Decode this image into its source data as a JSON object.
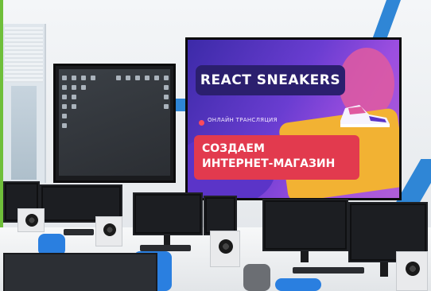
{
  "scene": {
    "description_colors": {
      "banner_bg": "#6a3dd1",
      "title_pill": "#2b1f6e",
      "subtitle_pill": "#e23a4e",
      "accent_stripe": "#2f86d6"
    }
  },
  "banner": {
    "title": "REACT SNEAKERS",
    "live_label": "ОНЛАЙН ТРАНСЛЯЦИЯ",
    "headline_line1": "СОЗДАЕМ",
    "headline_line2": "ИНТЕРНЕТ-МАГАЗИН"
  }
}
